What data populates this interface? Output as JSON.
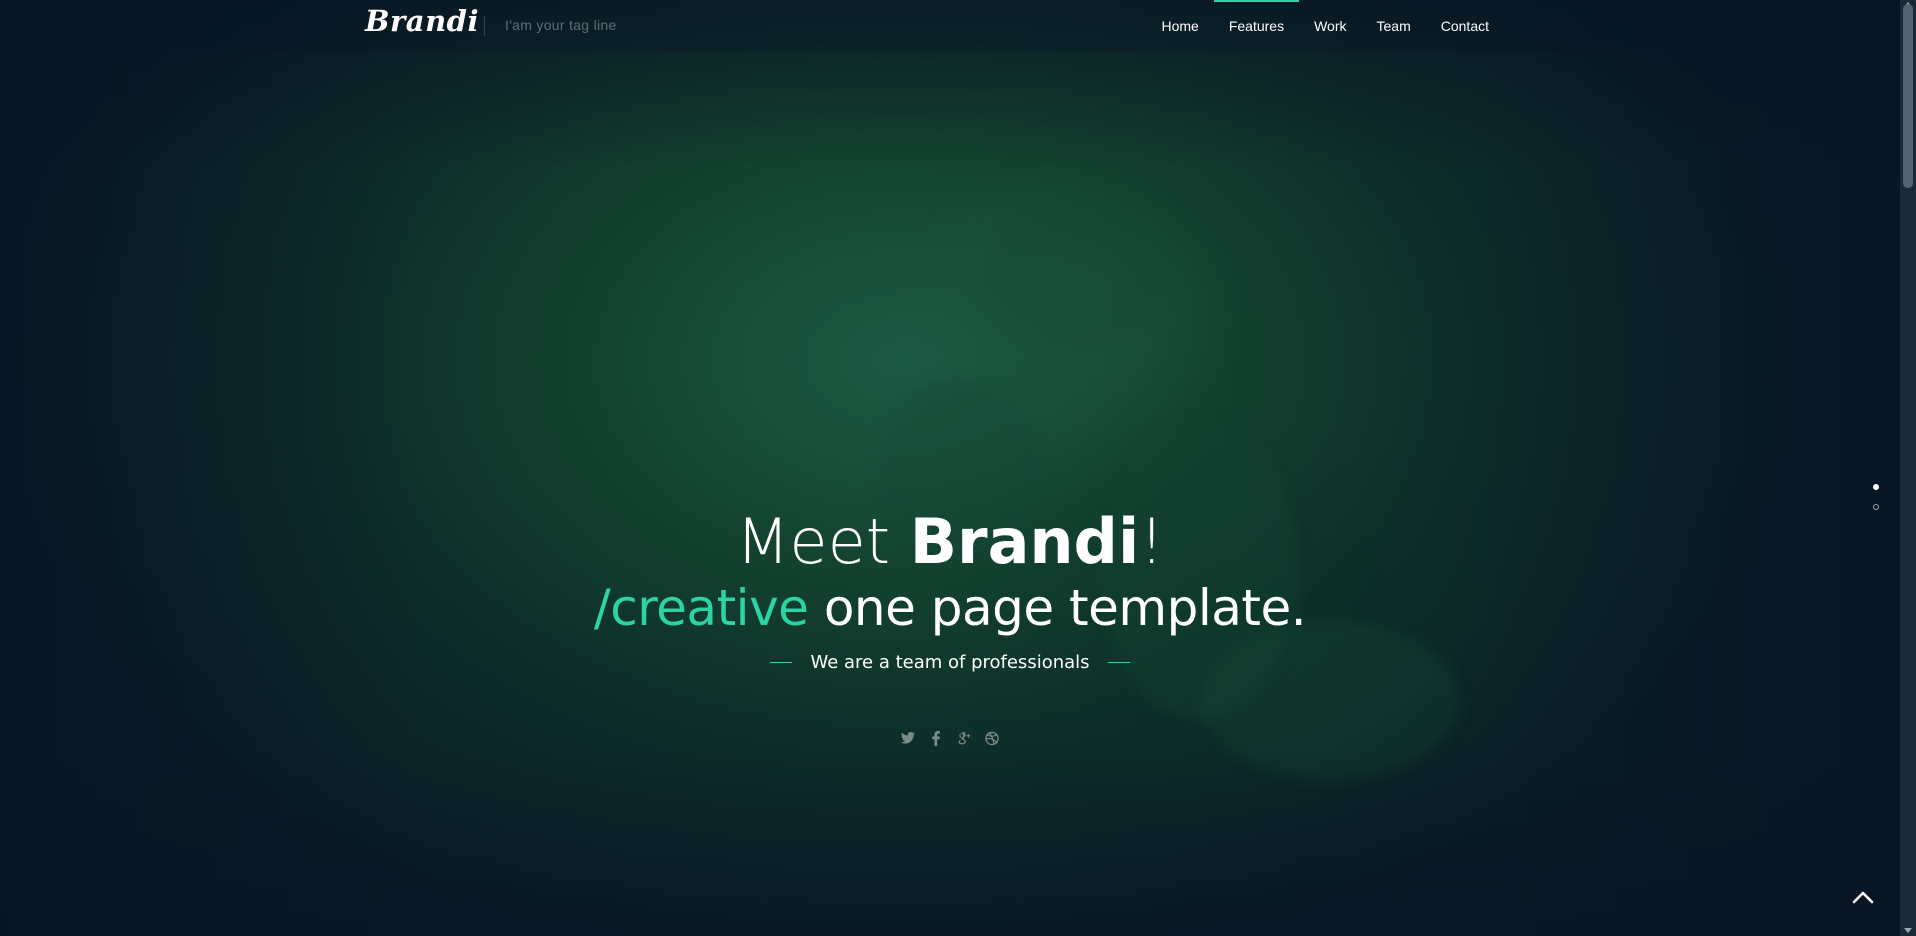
{
  "header": {
    "logo": "Brandi",
    "tagline": "I'am your tag line",
    "nav": [
      {
        "label": "Home",
        "active": false
      },
      {
        "label": "Features",
        "active": true
      },
      {
        "label": "Work",
        "active": false
      },
      {
        "label": "Team",
        "active": false
      },
      {
        "label": "Contact",
        "active": false
      }
    ]
  },
  "hero": {
    "title_prefix": "Meet ",
    "title_bold": "Brandi",
    "title_suffix": "!",
    "subtitle_accent": "/creative",
    "subtitle_rest": " one page template.",
    "tagline": "We are a team of professionals",
    "social": [
      {
        "icon": "twitter-icon",
        "glyph": "ᴛ"
      },
      {
        "icon": "facebook-icon",
        "glyph": "f"
      },
      {
        "icon": "google-plus-icon",
        "glyph": "g+"
      },
      {
        "icon": "dribbble-icon",
        "glyph": "◎"
      }
    ]
  },
  "slider": {
    "total": 2,
    "current": 1
  },
  "colors": {
    "accent": "#2bd4a2",
    "text": "#ffffff"
  }
}
